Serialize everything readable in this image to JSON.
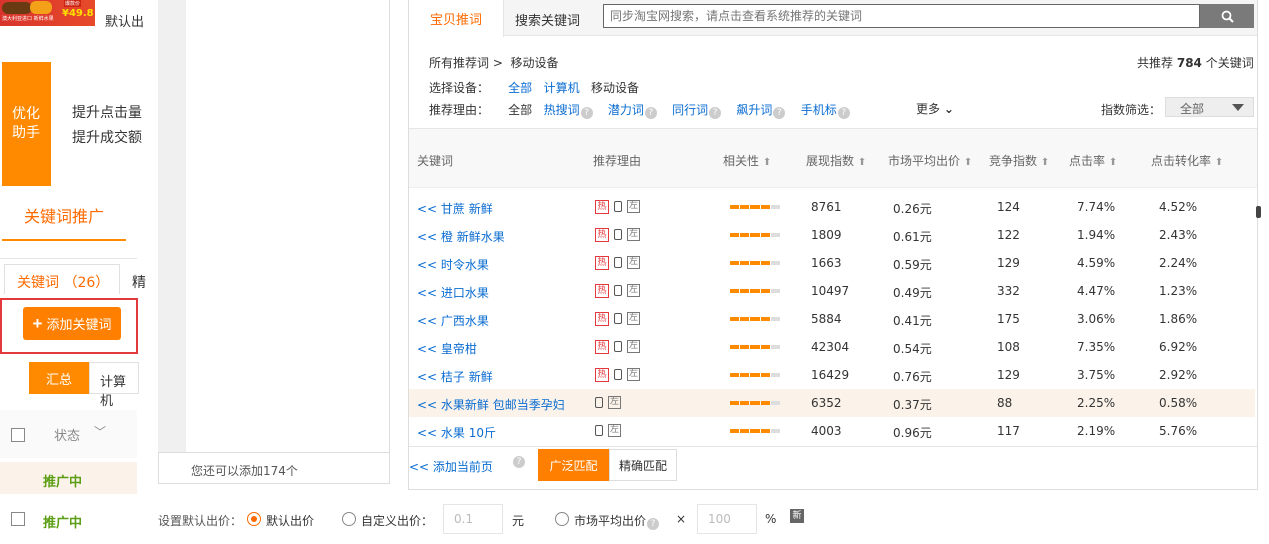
{
  "background_page": {
    "promo_banner": {
      "price": "¥49.8",
      "tag": "爆款价",
      "text": "澳大利亚进口 新鲜水果"
    },
    "default_bid_label": "默认出",
    "optimize_badge": "优化助手",
    "optimize_lines": [
      "提升点击量",
      "提升成交额"
    ],
    "keyword_promo_title": "关键词推广",
    "keyword_tab": "关键词 （26）",
    "other_tab": "精",
    "add_keyword_button": "添加关键词",
    "segment_total": "汇总",
    "segment_pc": "计算机",
    "status_header": "状态",
    "status_rows": [
      "推广中",
      "推广中"
    ]
  },
  "left_panel": {
    "footer_text": "您还可以添加174个"
  },
  "tabs": {
    "active": "宝贝推词",
    "search": "搜索关键词"
  },
  "search": {
    "placeholder": "同步淘宝网搜索，请点击查看系统推荐的关键词"
  },
  "breadcrumb": {
    "root": "所有推荐词 >",
    "current": "移动设备"
  },
  "total": {
    "prefix": "共推荐",
    "count": "784",
    "suffix": "个关键词"
  },
  "device": {
    "label": "选择设备：",
    "options": [
      "全部",
      "计算机",
      "移动设备"
    ]
  },
  "reason": {
    "label": "推荐理由：",
    "all": "全部",
    "options": [
      "热搜词",
      "潜力词",
      "同行词",
      "飙升词",
      "手机标"
    ],
    "more": "更多"
  },
  "index_filter": {
    "label": "指数筛选：",
    "value": "全部"
  },
  "table": {
    "columns": [
      "关键词",
      "推荐理由",
      "相关性",
      "展现指数",
      "市场平均出价",
      "竞争指数",
      "点击率",
      "点击转化率"
    ],
    "rows": [
      {
        "keyword": "<< 甘蔗 新鲜",
        "hot": true,
        "relevance": 4,
        "impressions": "8761",
        "avg_bid": "0.26元",
        "competition": "124",
        "ctr": "7.74%",
        "cvr": "4.52%"
      },
      {
        "keyword": "<< 橙 新鲜水果",
        "hot": true,
        "relevance": 4,
        "impressions": "1809",
        "avg_bid": "0.61元",
        "competition": "122",
        "ctr": "1.94%",
        "cvr": "2.43%"
      },
      {
        "keyword": "<< 时令水果",
        "hot": true,
        "relevance": 4,
        "impressions": "1663",
        "avg_bid": "0.59元",
        "competition": "129",
        "ctr": "4.59%",
        "cvr": "2.24%"
      },
      {
        "keyword": "<< 进口水果",
        "hot": true,
        "relevance": 4,
        "impressions": "10497",
        "avg_bid": "0.49元",
        "competition": "332",
        "ctr": "4.47%",
        "cvr": "1.23%"
      },
      {
        "keyword": "<< 广西水果",
        "hot": true,
        "relevance": 4,
        "impressions": "5884",
        "avg_bid": "0.41元",
        "competition": "175",
        "ctr": "3.06%",
        "cvr": "1.86%"
      },
      {
        "keyword": "<< 皇帝柑",
        "hot": true,
        "relevance": 4,
        "impressions": "42304",
        "avg_bid": "0.54元",
        "competition": "108",
        "ctr": "7.35%",
        "cvr": "6.92%"
      },
      {
        "keyword": "<< 桔子 新鲜",
        "hot": true,
        "relevance": 4,
        "impressions": "16429",
        "avg_bid": "0.76元",
        "competition": "129",
        "ctr": "3.75%",
        "cvr": "2.92%"
      },
      {
        "keyword": "<< 水果新鲜 包邮当季孕妇",
        "hot": false,
        "relevance": 4,
        "impressions": "6352",
        "avg_bid": "0.37元",
        "competition": "88",
        "ctr": "2.25%",
        "cvr": "0.58%"
      },
      {
        "keyword": "<< 水果 10斤",
        "hot": false,
        "relevance": 4,
        "impressions": "4003",
        "avg_bid": "0.96元",
        "competition": "117",
        "ctr": "2.19%",
        "cvr": "5.76%"
      }
    ],
    "hot_glyph": "热",
    "left_glyph": "左"
  },
  "footer": {
    "add_page": "<< 添加当前页",
    "broad": "广泛匹配",
    "exact": "精确匹配"
  },
  "bid_settings": {
    "label": "设置默认出价：",
    "default": "默认出价",
    "custom": "自定义出价：",
    "custom_value": "0.1",
    "custom_unit": "元",
    "market": "市场平均出价",
    "times": "×",
    "percent_value": "100",
    "percent_unit": "%",
    "new_badge": "新"
  },
  "colors": {
    "accent": "#ff6a00",
    "link": "#0a6cd1",
    "status_green": "#5b9e14"
  }
}
